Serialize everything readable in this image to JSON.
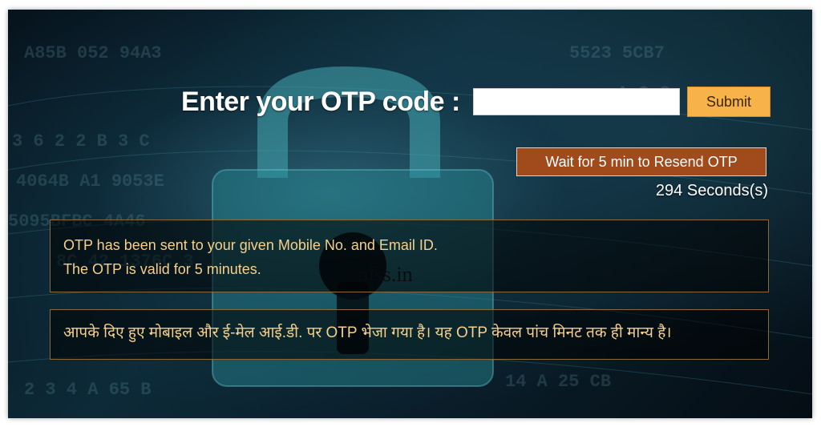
{
  "otp_form": {
    "label": "Enter your OTP code :",
    "input_value": "",
    "submit_label": "Submit"
  },
  "resend": {
    "button_label": "Wait for 5 min to Resend OTP",
    "countdown_text": "294 Seconds(s)"
  },
  "messages": {
    "english_line1": "OTP has been sent to your given Mobile No. and Email ID.",
    "english_line2": "The OTP is valid for 5 minutes.",
    "hindi": "आपके दिए हुए मोबाइल और ई-मेल आई.डी. पर OTP भेजा गया है। यह OTP केवल पांच मिनट तक ही मान्य है।"
  },
  "watermark": "ofss.in",
  "colors": {
    "submit_bg": "#f7b34a",
    "resend_bg": "#a14a1b",
    "message_text": "#f6d08a",
    "message_border": "#8a6a3a"
  }
}
